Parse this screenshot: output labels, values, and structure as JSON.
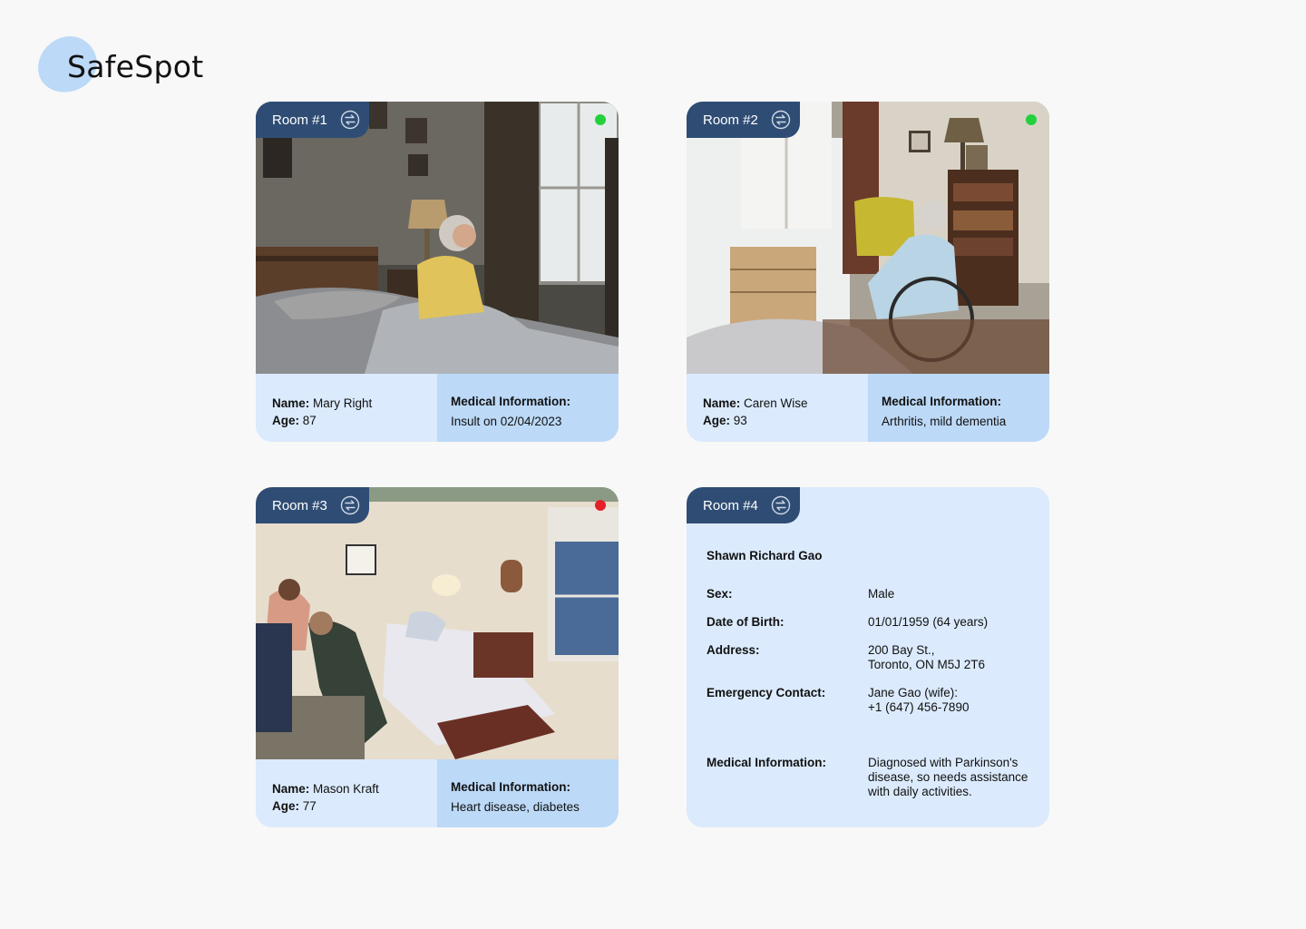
{
  "app": {
    "name": "SafeSpot"
  },
  "rooms": [
    {
      "label": "Room #1",
      "status_color": "#22d13b",
      "name_label": "Name:",
      "name": "Mary Right",
      "age_label": "Age:",
      "age": "87",
      "medical_label": "Medical Information:",
      "medical": "Insult on 02/04/2023"
    },
    {
      "label": "Room #2",
      "status_color": "#22d13b",
      "name_label": "Name:",
      "name": "Caren Wise",
      "age_label": "Age:",
      "age": "93",
      "medical_label": "Medical Information:",
      "medical": "Arthritis, mild dementia"
    },
    {
      "label": "Room #3",
      "status_color": "#e5202a",
      "name_label": "Name:",
      "name": "Mason Kraft",
      "age_label": "Age:",
      "age": "77",
      "medical_label": "Medical Information:",
      "medical": "Heart disease, diabetes"
    },
    {
      "label": "Room #4",
      "patient": {
        "full_name": "Shawn Richard Gao",
        "sex_label": "Sex:",
        "sex": "Male",
        "dob_label": "Date of Birth:",
        "dob": "01/01/1959 (64 years)",
        "address_label": "Address:",
        "address_line1": "200 Bay St.,",
        "address_line2": "Toronto, ON M5J 2T6",
        "emergency_label": "Emergency Contact:",
        "emergency_line1": "Jane Gao (wife):",
        "emergency_line2": "+1 (647) 456-7890",
        "medical_label": "Medical Information:",
        "medical_line1": "Diagnosed with Parkinson's",
        "medical_line2": "disease, so needs assistance",
        "medical_line3": "with daily activities."
      }
    }
  ],
  "colors": {
    "accent": "#2f4d74",
    "card_bg": "#dbeafc",
    "card_accent_bg": "#bcd9f7",
    "status_ok": "#22d13b",
    "status_alert": "#e5202a"
  },
  "icons": {
    "room_switch": "swap-arrows-icon",
    "status": "status-dot"
  }
}
